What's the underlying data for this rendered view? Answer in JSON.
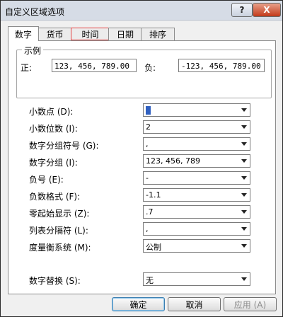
{
  "window": {
    "title": "自定义区域选项"
  },
  "titlebar": {
    "help_label": "?",
    "close_label": "X"
  },
  "tabs": [
    {
      "label": "数字",
      "active": true
    },
    {
      "label": "货币",
      "active": false
    },
    {
      "label": "时间",
      "active": false,
      "highlighted": true
    },
    {
      "label": "日期",
      "active": false
    },
    {
      "label": "排序",
      "active": false
    }
  ],
  "sample": {
    "legend": "示例",
    "positive_label": "正:",
    "positive_value": "123, 456, 789.00",
    "negative_label": "负:",
    "negative_value": "-123, 456, 789.00"
  },
  "settings": [
    {
      "label": "小数点 (D):",
      "value": ""
    },
    {
      "label": "小数位数 (I):",
      "value": "2"
    },
    {
      "label": "数字分组符号 (G):",
      "value": ","
    },
    {
      "label": "数字分组 (I):",
      "value": "123, 456, 789"
    },
    {
      "label": "负号 (E):",
      "value": "-"
    },
    {
      "label": "负数格式 (F):",
      "value": "-1.1"
    },
    {
      "label": "零起始显示 (Z):",
      "value": ".7"
    },
    {
      "label": "列表分隔符 (L):",
      "value": ","
    },
    {
      "label": "度量衡系统 (M):",
      "value": "公制"
    }
  ],
  "digit_substitution": {
    "label": "数字替换 (S):",
    "value": "无"
  },
  "buttons": {
    "ok": "确定",
    "cancel": "取消",
    "apply": "应用 (A)"
  }
}
